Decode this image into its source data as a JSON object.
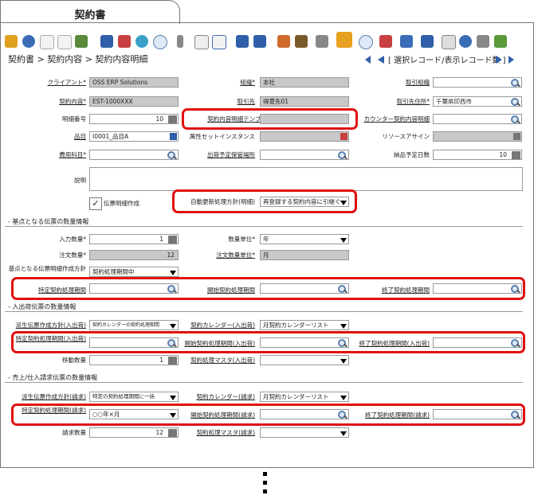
{
  "tab": {
    "title": "契約書"
  },
  "breadcrumb": {
    "text": "契約書 > 契約内容 > 契約内容明細"
  },
  "record_nav": {
    "text": "[ 選択レコード/表示レコード数 ]"
  },
  "fields": {
    "client": {
      "label": "クライアント*",
      "value": "OSS ERP Solutions"
    },
    "org": {
      "label": "組織*",
      "value": "本社"
    },
    "trade_org": {
      "label": "取引組織",
      "value": ""
    },
    "contract": {
      "label": "契約内容*",
      "value": "EST-1000XXX"
    },
    "partner": {
      "label": "取引先",
      "value": "得意先01"
    },
    "partner_loc": {
      "label": "取引先住所*",
      "value": "千葉県印西市"
    },
    "line_no": {
      "label": "明細番号",
      "value": "10"
    },
    "template": {
      "label": "契約内容明細テンプレート",
      "value": ""
    },
    "counter_line": {
      "label": "カウンター契約内容明細",
      "value": ""
    },
    "product": {
      "label": "品目",
      "value": "I0001_品目A"
    },
    "attr_set": {
      "label": "属性セットインスタンス",
      "value": ""
    },
    "resource": {
      "label": "リソースアサイン",
      "value": ""
    },
    "charge": {
      "label": "費用科目*",
      "value": ""
    },
    "warehouse": {
      "label": "出荷予定保管場所",
      "value": ""
    },
    "lead_days": {
      "label": "納品予定日数",
      "value": "10"
    },
    "description": {
      "label": "説明",
      "value": ""
    },
    "create_line": {
      "label": "伝票明細作成",
      "check": "✓"
    },
    "auto_update": {
      "label": "自動更新処理方針(明細)",
      "value": "再登録する契約内容に引継ぐ"
    }
  },
  "sections": {
    "base": "- 基点となる伝票の数量情報",
    "io": "- 入出荷伝票の数量情報",
    "inv": "- 売上/仕入請求伝票の数量情報"
  },
  "base": {
    "qty_entered": {
      "label": "入力数量*",
      "value": "1"
    },
    "uom": {
      "label": "数量単位*",
      "value": "年"
    },
    "qty_ordered": {
      "label": "注文数量*",
      "value": "12"
    },
    "uom_ordered": {
      "label": "注文数量単位*",
      "value": "月"
    },
    "doc_policy": {
      "label": "基点となる伝票明細作成方針",
      "value": "契約処理期間中"
    },
    "specific_period": {
      "label": "特定契約処理期間",
      "value": ""
    },
    "start_period": {
      "label": "開始契約処理期間",
      "value": ""
    },
    "end_period": {
      "label": "終了契約処理期間",
      "value": ""
    }
  },
  "io": {
    "derive_policy": {
      "label": "派生伝票作成方針(入出荷)",
      "value": "契約カレンダーの契約処理期間"
    },
    "calendar": {
      "label": "契約カレンダー(入出荷)",
      "value": "月契約カレンダーリスト"
    },
    "specific_period": {
      "label": "特定契約処理期間(入出荷)",
      "value": ""
    },
    "start_period": {
      "label": "開始契約処理期間(入出荷)",
      "value": ""
    },
    "end_period": {
      "label": "終了契約処理期間(入出荷)",
      "value": ""
    },
    "move_qty": {
      "label": "移動数量",
      "value": "1"
    },
    "master": {
      "label": "契約処理マスタ(入出荷)",
      "value": ""
    }
  },
  "inv": {
    "derive_policy": {
      "label": "派生伝票作成方針(請求)",
      "value": "特定の契約処理期間に一括"
    },
    "calendar": {
      "label": "契約カレンダー(請求)",
      "value": "月契約カレンダーリスト"
    },
    "specific_period": {
      "label": "特定契約処理期間(請求)",
      "value": "○○年×月"
    },
    "start_period": {
      "label": "開始契約処理期間(請求)",
      "value": ""
    },
    "end_period": {
      "label": "終了契約処理期間(請求)",
      "value": ""
    },
    "inv_qty": {
      "label": "請求数量",
      "value": "12"
    },
    "master": {
      "label": "契約処理マスタ(請求)",
      "value": ""
    }
  },
  "colors": {
    "highlight": "#e01010",
    "readonly": "#c8c8c8"
  }
}
